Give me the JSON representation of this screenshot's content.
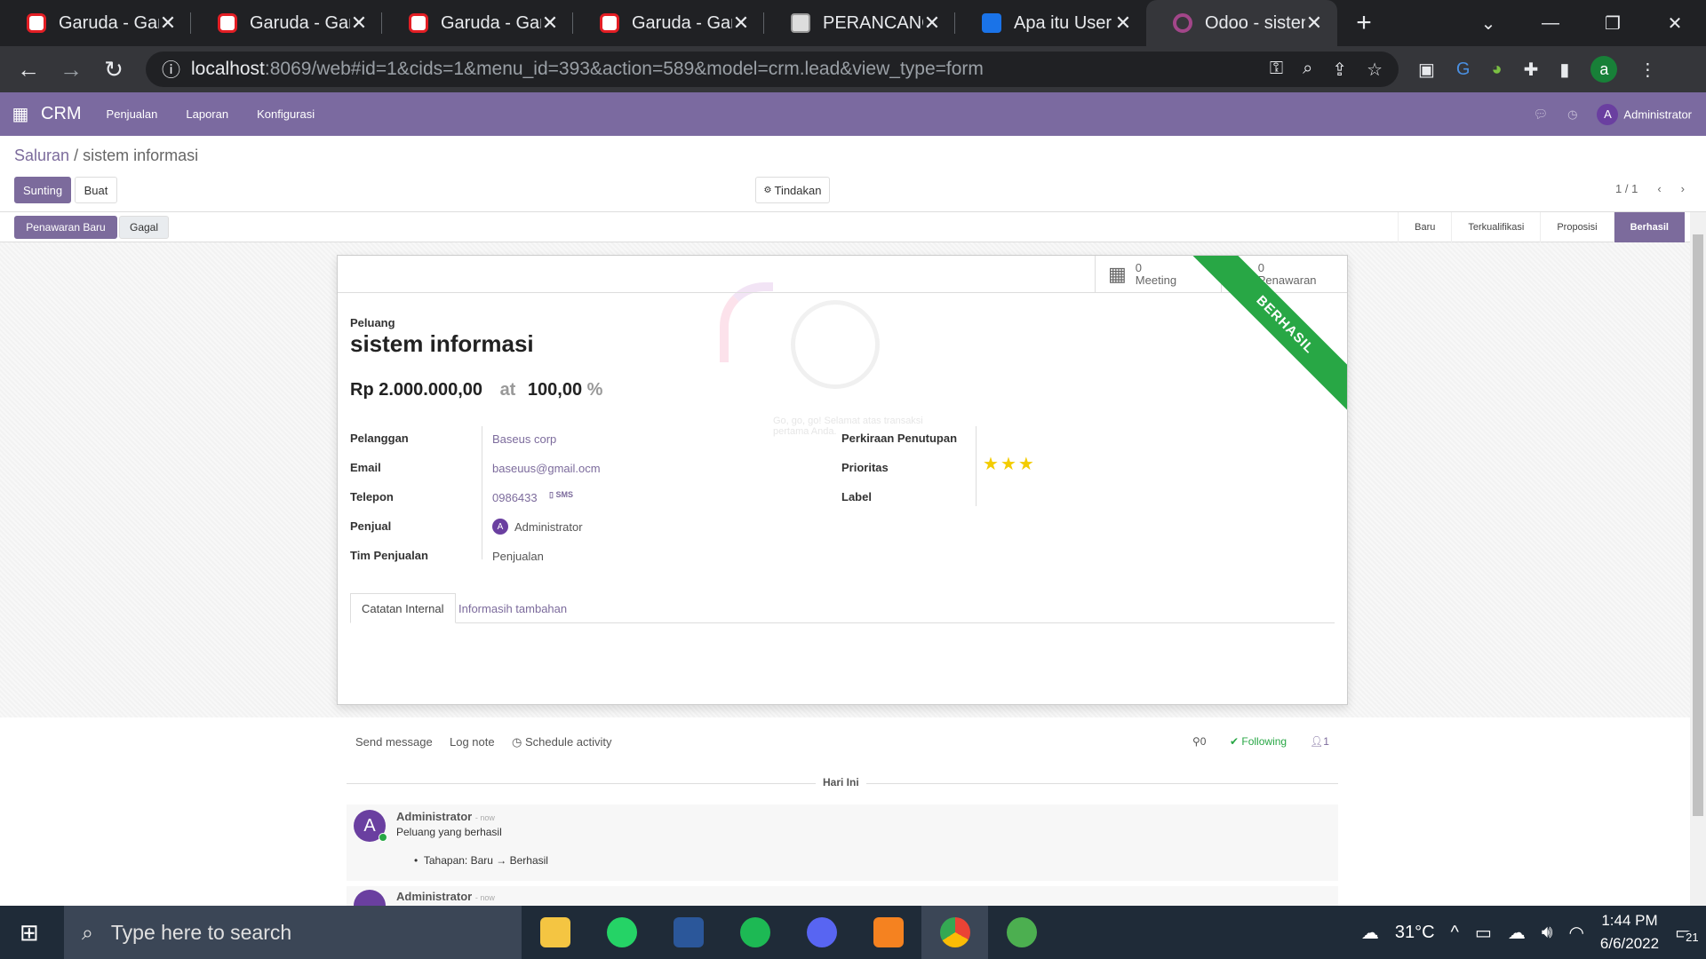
{
  "browser": {
    "tabs": [
      {
        "title": "Garuda - Garba",
        "icon": "garuda"
      },
      {
        "title": "Garuda - Garba",
        "icon": "garuda"
      },
      {
        "title": "Garuda - Garba",
        "icon": "garuda"
      },
      {
        "title": "Garuda - Garba",
        "icon": "garuda"
      },
      {
        "title": "PERANCANGA",
        "icon": "doc"
      },
      {
        "title": "Apa itu User In",
        "icon": "wave"
      },
      {
        "title": "Odoo - sistem",
        "icon": "odoo"
      }
    ],
    "url_host": "localhost",
    "url_rest": ":8069/web#id=1&cids=1&menu_id=393&action=589&model=crm.lead&view_type=form",
    "profile_letter": "a"
  },
  "odoo_nav": {
    "app": "CRM",
    "menu": [
      "Penjualan",
      "Laporan",
      "Konfigurasi"
    ],
    "user_initial": "A",
    "user": "Administrator"
  },
  "control": {
    "breadcrumb_link": "Saluran",
    "breadcrumb_sep": "/",
    "breadcrumb_current": "sistem informasi",
    "edit": "Sunting",
    "create": "Buat",
    "action": "Tindakan",
    "pager": "1 / 1"
  },
  "statusbar": {
    "new_quote": "Penawaran Baru",
    "lost": "Gagal",
    "stages": [
      "Baru",
      "Terkualifikasi",
      "Proposisi",
      "Berhasil"
    ],
    "current": "Berhasil"
  },
  "form": {
    "meeting_count": "0",
    "meeting_label": "Meeting",
    "quote_count": "0",
    "quote_label": "Penawaran",
    "ribbon": "BERHASIL",
    "kind_label": "Peluang",
    "name": "sistem informasi",
    "revenue": "Rp 2.000.000,00",
    "at": "at",
    "probability": "100,00",
    "percent": "%",
    "watermark": "Go, go, go! Selamat atas transaksi pertama Anda.",
    "left_fields": [
      {
        "label": "Pelanggan",
        "value": "Baseus corp"
      },
      {
        "label": "Email",
        "value": "baseuus@gmail.ocm"
      },
      {
        "label": "Telepon",
        "value": "0986433"
      },
      {
        "label": "Penjual",
        "value": "Administrator"
      },
      {
        "label": "Tim Penjualan",
        "value": "Penjualan"
      }
    ],
    "sms": "SMS",
    "right_fields": [
      {
        "label": "Perkiraan Penutupan"
      },
      {
        "label": "Prioritas"
      },
      {
        "label": "Label"
      }
    ],
    "priority_stars": 3,
    "tabs": [
      "Catatan Internal",
      "Informasih tambahan"
    ]
  },
  "chatter": {
    "send": "Send message",
    "log": "Log note",
    "schedule": "Schedule activity",
    "attachments": "0",
    "following": "Following",
    "followers": "1",
    "day": "Hari Ini",
    "messages": [
      {
        "author": "Administrator",
        "time": "- now",
        "body": "Peluang yang berhasil",
        "detail": "Tahapan: Baru → Berhasil"
      },
      {
        "author": "Administrator",
        "time": "- now"
      }
    ]
  },
  "taskbar": {
    "search_placeholder": "Type here to search",
    "temp": "31°C",
    "time": "1:44 PM",
    "date": "6/6/2022",
    "notif": "21"
  }
}
